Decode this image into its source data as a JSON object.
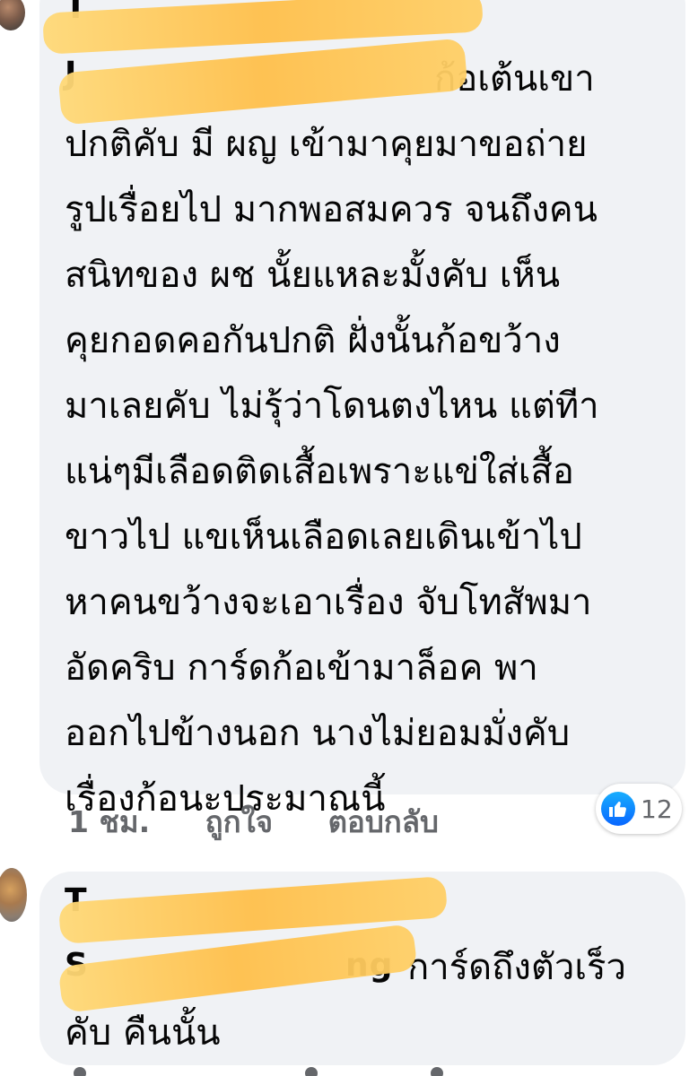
{
  "comments": [
    {
      "author_name": "T",
      "author_line2": "J",
      "text": "ก้อเต้นเขา\nปกติคับ มี ผญ เข้ามาคุยมาขอถ่าย\nรูปเรื่อยไป มากพอสมควร จนถึงคน\nสนิทของ ผช นั้ยแหละมั้งคับ เห็น\nคุยกอดคอกันปกติ ฝั่งนั้นก้อขว้าง\nมาเลยคับ ไม่รุ้ว่าโดนตงไหน แต่ทีา\nแน่ๆมีเลือดติดเสื้อเพราะแข่ใส่เสื้อ\nขาวไป แขเห็นเลือดเลยเดินเข้าไป\nหาคนขว้างจะเอาเรื่อง จับโทสัพมา\nอัดคริบ การ์ดก้อเข้ามาล็อค พา\nออกไปข้างนอก นางไม่ยอมมั่งคับ\nเรื่องก้อนะประมาณนี้",
      "time": "1 ชม.",
      "like_label": "ถูกใจ",
      "reply_label": "ตอบกลับ",
      "reaction_icon": "like-icon",
      "reaction_count": "12"
    },
    {
      "author_name": "T",
      "author_line2": "S",
      "author_tail": "ng",
      "text": "การ์ดถึงตัวเร็ว\nคับ คืนนั้น"
    }
  ],
  "colors": {
    "bubble": "#f0f2f5",
    "secondary_text": "#65676b",
    "like_blue": "#0866ff",
    "redaction": "#ffc24f"
  }
}
